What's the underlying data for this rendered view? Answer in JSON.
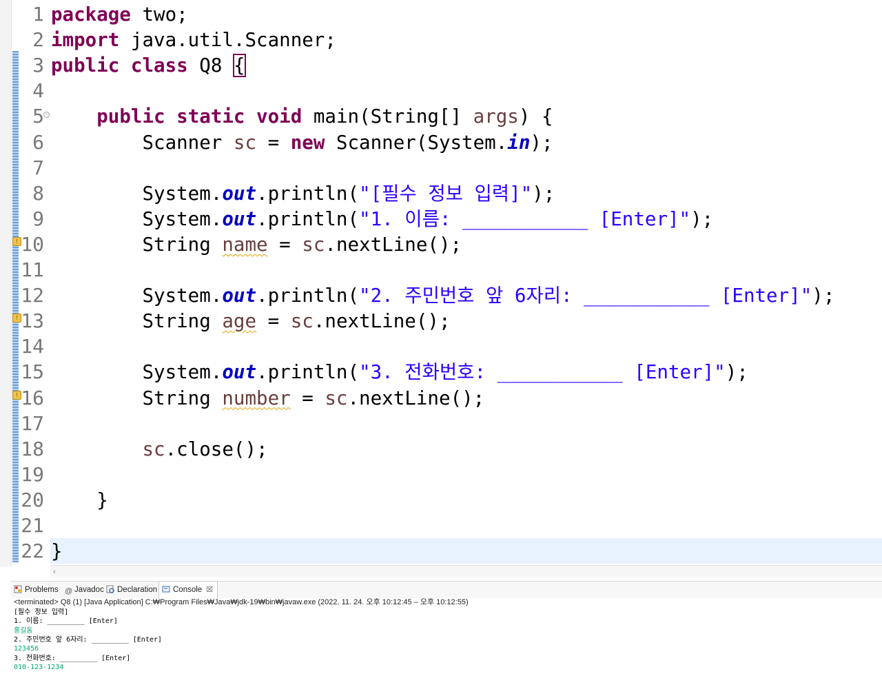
{
  "editor": {
    "lines": [
      {
        "n": "1",
        "segments": [
          {
            "t": "package",
            "c": "kw"
          },
          {
            "t": " two;"
          }
        ]
      },
      {
        "n": "2",
        "segments": [
          {
            "t": "import",
            "c": "kw"
          },
          {
            "t": " java.util.Scanner;"
          }
        ]
      },
      {
        "n": "3",
        "segments": [
          {
            "t": "public",
            "c": "kw"
          },
          {
            "t": " "
          },
          {
            "t": "class",
            "c": "kw"
          },
          {
            "t": " Q8 "
          },
          {
            "t": "{",
            "c": "bracket"
          }
        ]
      },
      {
        "n": "4",
        "segments": []
      },
      {
        "n": "5",
        "fold": true,
        "segments": [
          {
            "t": "    "
          },
          {
            "t": "public",
            "c": "kw"
          },
          {
            "t": " "
          },
          {
            "t": "static",
            "c": "kw"
          },
          {
            "t": " "
          },
          {
            "t": "void",
            "c": "kw"
          },
          {
            "t": " main(String[] "
          },
          {
            "t": "args",
            "c": "lv"
          },
          {
            "t": ") {"
          }
        ]
      },
      {
        "n": "6",
        "segments": [
          {
            "t": "        Scanner "
          },
          {
            "t": "sc",
            "c": "lv"
          },
          {
            "t": " = "
          },
          {
            "t": "new",
            "c": "kw"
          },
          {
            "t": " Scanner(System."
          },
          {
            "t": "in",
            "c": "fd"
          },
          {
            "t": ");"
          }
        ]
      },
      {
        "n": "7",
        "segments": []
      },
      {
        "n": "8",
        "segments": [
          {
            "t": "        System."
          },
          {
            "t": "out",
            "c": "fd"
          },
          {
            "t": ".println("
          },
          {
            "t": "\"[필수 정보 입력]\"",
            "c": "st"
          },
          {
            "t": ");"
          }
        ]
      },
      {
        "n": "9",
        "segments": [
          {
            "t": "        System."
          },
          {
            "t": "out",
            "c": "fd"
          },
          {
            "t": ".println("
          },
          {
            "t": "\"1. 이름: ___________ [Enter]\"",
            "c": "st"
          },
          {
            "t": ");"
          }
        ]
      },
      {
        "n": "10",
        "marker": true,
        "segments": [
          {
            "t": "        String "
          },
          {
            "t": "name",
            "c": "lv warn-u"
          },
          {
            "t": " = "
          },
          {
            "t": "sc",
            "c": "lv"
          },
          {
            "t": ".nextLine();"
          }
        ]
      },
      {
        "n": "11",
        "segments": []
      },
      {
        "n": "12",
        "segments": [
          {
            "t": "        System."
          },
          {
            "t": "out",
            "c": "fd"
          },
          {
            "t": ".println("
          },
          {
            "t": "\"2. 주민번호 앞 6자리: ___________ [Enter]\"",
            "c": "st"
          },
          {
            "t": ");"
          }
        ]
      },
      {
        "n": "13",
        "marker": true,
        "segments": [
          {
            "t": "        String "
          },
          {
            "t": "age",
            "c": "lv warn-u"
          },
          {
            "t": " = "
          },
          {
            "t": "sc",
            "c": "lv"
          },
          {
            "t": ".nextLine();"
          }
        ]
      },
      {
        "n": "14",
        "segments": []
      },
      {
        "n": "15",
        "segments": [
          {
            "t": "        System."
          },
          {
            "t": "out",
            "c": "fd"
          },
          {
            "t": ".println("
          },
          {
            "t": "\"3. 전화번호: ___________ [Enter]\"",
            "c": "st"
          },
          {
            "t": ");"
          }
        ]
      },
      {
        "n": "16",
        "marker": true,
        "segments": [
          {
            "t": "        String "
          },
          {
            "t": "number",
            "c": "lv warn-u"
          },
          {
            "t": " = "
          },
          {
            "t": "sc",
            "c": "lv"
          },
          {
            "t": ".nextLine();"
          }
        ]
      },
      {
        "n": "17",
        "segments": []
      },
      {
        "n": "18",
        "segments": [
          {
            "t": "        "
          },
          {
            "t": "sc",
            "c": "lv"
          },
          {
            "t": ".close();"
          }
        ]
      },
      {
        "n": "19",
        "segments": []
      },
      {
        "n": "20",
        "segments": [
          {
            "t": "    }"
          }
        ]
      },
      {
        "n": "21",
        "segments": []
      },
      {
        "n": "22",
        "current": true,
        "segments": [
          {
            "t": "}"
          }
        ]
      }
    ]
  },
  "tabs": [
    {
      "label": "Problems",
      "icon": "problems-icon"
    },
    {
      "label": "Javadoc",
      "icon": "javadoc-icon"
    },
    {
      "label": "Declaration",
      "icon": "declaration-icon"
    },
    {
      "label": "Console",
      "icon": "console-icon",
      "active": true
    }
  ],
  "console": {
    "header": "<terminated> Q8 (1) [Java Application] C:₩Program Files₩Java₩jdk-19₩bin₩javaw.exe  (2022. 11. 24. 오후 10:12:45 – 오후 10:12:55)",
    "lines": [
      {
        "t": "[필수 정보 입력]",
        "in": false
      },
      {
        "t": "1. 이름: _________ [Enter]",
        "in": false
      },
      {
        "t": "홍길동",
        "in": true
      },
      {
        "t": "2. 주민번호 앞 6자리: _________ [Enter]",
        "in": false
      },
      {
        "t": "123456",
        "in": true
      },
      {
        "t": "3. 전화번호: _________ [Enter]",
        "in": false
      },
      {
        "t": "010-123-1234",
        "in": true
      }
    ]
  }
}
